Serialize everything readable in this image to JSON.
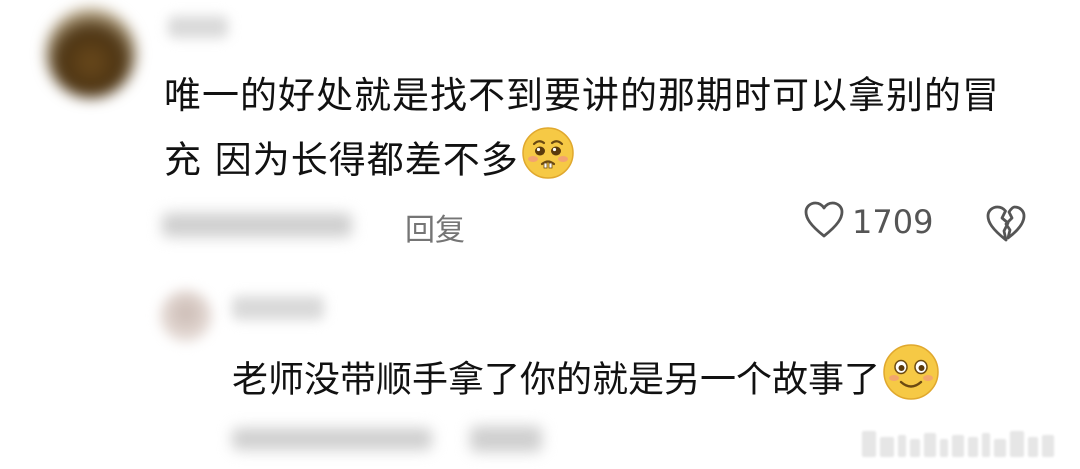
{
  "comment": {
    "text": "唯一的好处就是找不到要讲的那期时可以拿别的冒充 因为长得都差不多",
    "emoji_icon": "pleading-face-icon",
    "reply_label": "回复",
    "like_count": "1709",
    "like_icon": "heart-outline-icon",
    "dislike_icon": "broken-heart-icon"
  },
  "reply": {
    "text": "老师没带顺手拿了你的就是另一个故事了",
    "emoji_icon": "smiling-face-icon"
  },
  "colors": {
    "text": "#111111",
    "muted": "#757575",
    "icon": "#555555",
    "emoji_yellow": "#F6C945",
    "background": "#ffffff"
  }
}
